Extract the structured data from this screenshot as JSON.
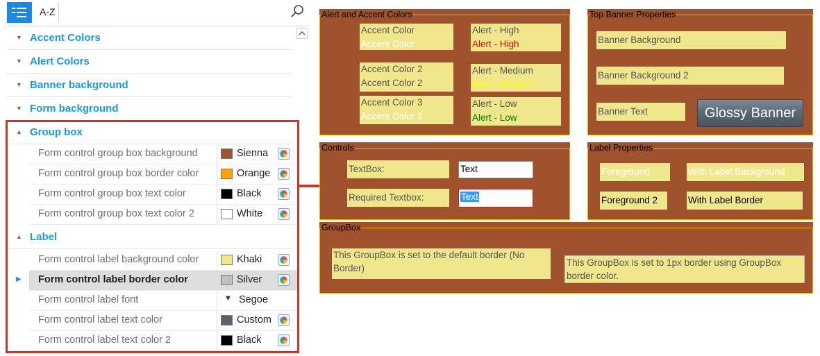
{
  "toolbar": {
    "sort_label": "A-Z"
  },
  "categories": [
    {
      "label": "Accent Colors"
    },
    {
      "label": "Alert Colors"
    },
    {
      "label": "Banner background"
    },
    {
      "label": "Form background"
    },
    {
      "label": "Group box"
    },
    {
      "label": "Label"
    }
  ],
  "group_box_props": [
    {
      "name": "Form control group box background",
      "value": "Sienna",
      "color": "#a0522d"
    },
    {
      "name": "Form control group box border color",
      "value": "Orange",
      "color": "#ffa500"
    },
    {
      "name": "Form control group box text color",
      "value": "Black",
      "color": "#000000"
    },
    {
      "name": "Form control group box text color 2",
      "value": "White",
      "color": "#ffffff"
    }
  ],
  "label_props": [
    {
      "name": "Form control label background color",
      "value": "Khaki",
      "color": "#f0e68c"
    },
    {
      "name": "Form control label border color",
      "value": "Silver",
      "color": "#c0c0c0"
    },
    {
      "name": "Form control label font",
      "value": "Segoe"
    },
    {
      "name": "Form control label text color",
      "value": "Custom",
      "color": "#5a6470"
    },
    {
      "name": "Form control label text color 2",
      "value": "Black",
      "color": "#000000"
    }
  ],
  "preview": {
    "alert_accent": {
      "title": "Alert and Accent Colors",
      "accent_color": "Accent Color",
      "accent_color_alt": "Accent Color",
      "alert_high": "Alert - High",
      "alert_high_alt": "Alert - High",
      "accent_color_2": "Accent Color 2",
      "accent_color_2_alt": "Accent Color 2",
      "alert_medium": "Alert - Medium",
      "alert_medium_alt": "Alert - Medium",
      "accent_color_3": "Accent Color 3",
      "accent_color_3_alt": "Accent Color 3",
      "alert_low": "Alert - Low",
      "alert_low_alt": "Alert - Low"
    },
    "top_banner": {
      "title": "Top Banner Properties",
      "background": "Banner Background",
      "background_2": "Banner Background 2",
      "text": "Banner Text",
      "glossy": "Glossy Banner"
    },
    "controls": {
      "title": "Controls",
      "textbox_label": "TextBox:",
      "textbox_value": "Text",
      "required_label": "Required Textbox:",
      "required_value": "Text"
    },
    "label_properties": {
      "title": "Label Properties",
      "foreground": "Foreground",
      "with_background": "With Label Background",
      "foreground_2": "Foreground 2",
      "with_border": "With Label Border"
    },
    "groupbox": {
      "title": "GroupBox",
      "default_border": "This GroupBox is set to the default border (No Border)",
      "one_px_border": "This GroupBox is set to 1px border using GroupBox border color."
    }
  },
  "colors": {
    "sienna": "#a0522d",
    "orange": "#ffa500",
    "khaki": "#f0e68c",
    "alert_high": "#ff0000",
    "alert_medium": "#ffff00",
    "alert_low": "#008000",
    "category_blue": "#1c9ad6",
    "highlight_red": "#c0392b"
  }
}
